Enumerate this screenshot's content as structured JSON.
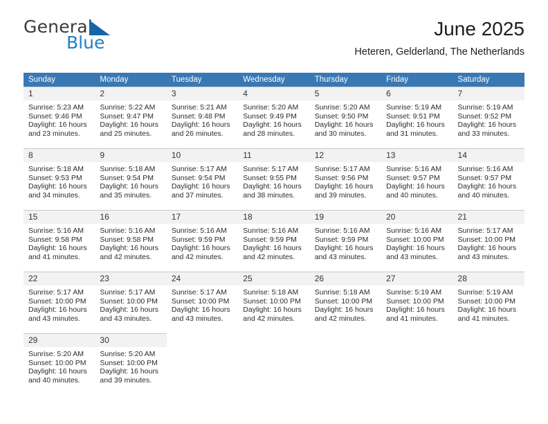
{
  "brand": {
    "name_top": "General",
    "name_bottom": "Blue",
    "triangle_color": "#1565a8",
    "blue_color": "#1f7fc4"
  },
  "header": {
    "title": "June 2025",
    "subtitle": "Heteren, Gelderland, The Netherlands"
  },
  "calendar": {
    "header_bg": "#3878b4",
    "daynum_bg": "#f2f2f2",
    "weekdays": [
      "Sunday",
      "Monday",
      "Tuesday",
      "Wednesday",
      "Thursday",
      "Friday",
      "Saturday"
    ],
    "weeks": [
      [
        {
          "day": "1",
          "sunrise": "Sunrise: 5:23 AM",
          "sunset": "Sunset: 9:46 PM",
          "daylight_1": "Daylight: 16 hours",
          "daylight_2": "and 23 minutes."
        },
        {
          "day": "2",
          "sunrise": "Sunrise: 5:22 AM",
          "sunset": "Sunset: 9:47 PM",
          "daylight_1": "Daylight: 16 hours",
          "daylight_2": "and 25 minutes."
        },
        {
          "day": "3",
          "sunrise": "Sunrise: 5:21 AM",
          "sunset": "Sunset: 9:48 PM",
          "daylight_1": "Daylight: 16 hours",
          "daylight_2": "and 26 minutes."
        },
        {
          "day": "4",
          "sunrise": "Sunrise: 5:20 AM",
          "sunset": "Sunset: 9:49 PM",
          "daylight_1": "Daylight: 16 hours",
          "daylight_2": "and 28 minutes."
        },
        {
          "day": "5",
          "sunrise": "Sunrise: 5:20 AM",
          "sunset": "Sunset: 9:50 PM",
          "daylight_1": "Daylight: 16 hours",
          "daylight_2": "and 30 minutes."
        },
        {
          "day": "6",
          "sunrise": "Sunrise: 5:19 AM",
          "sunset": "Sunset: 9:51 PM",
          "daylight_1": "Daylight: 16 hours",
          "daylight_2": "and 31 minutes."
        },
        {
          "day": "7",
          "sunrise": "Sunrise: 5:19 AM",
          "sunset": "Sunset: 9:52 PM",
          "daylight_1": "Daylight: 16 hours",
          "daylight_2": "and 33 minutes."
        }
      ],
      [
        {
          "day": "8",
          "sunrise": "Sunrise: 5:18 AM",
          "sunset": "Sunset: 9:53 PM",
          "daylight_1": "Daylight: 16 hours",
          "daylight_2": "and 34 minutes."
        },
        {
          "day": "9",
          "sunrise": "Sunrise: 5:18 AM",
          "sunset": "Sunset: 9:54 PM",
          "daylight_1": "Daylight: 16 hours",
          "daylight_2": "and 35 minutes."
        },
        {
          "day": "10",
          "sunrise": "Sunrise: 5:17 AM",
          "sunset": "Sunset: 9:54 PM",
          "daylight_1": "Daylight: 16 hours",
          "daylight_2": "and 37 minutes."
        },
        {
          "day": "11",
          "sunrise": "Sunrise: 5:17 AM",
          "sunset": "Sunset: 9:55 PM",
          "daylight_1": "Daylight: 16 hours",
          "daylight_2": "and 38 minutes."
        },
        {
          "day": "12",
          "sunrise": "Sunrise: 5:17 AM",
          "sunset": "Sunset: 9:56 PM",
          "daylight_1": "Daylight: 16 hours",
          "daylight_2": "and 39 minutes."
        },
        {
          "day": "13",
          "sunrise": "Sunrise: 5:16 AM",
          "sunset": "Sunset: 9:57 PM",
          "daylight_1": "Daylight: 16 hours",
          "daylight_2": "and 40 minutes."
        },
        {
          "day": "14",
          "sunrise": "Sunrise: 5:16 AM",
          "sunset": "Sunset: 9:57 PM",
          "daylight_1": "Daylight: 16 hours",
          "daylight_2": "and 40 minutes."
        }
      ],
      [
        {
          "day": "15",
          "sunrise": "Sunrise: 5:16 AM",
          "sunset": "Sunset: 9:58 PM",
          "daylight_1": "Daylight: 16 hours",
          "daylight_2": "and 41 minutes."
        },
        {
          "day": "16",
          "sunrise": "Sunrise: 5:16 AM",
          "sunset": "Sunset: 9:58 PM",
          "daylight_1": "Daylight: 16 hours",
          "daylight_2": "and 42 minutes."
        },
        {
          "day": "17",
          "sunrise": "Sunrise: 5:16 AM",
          "sunset": "Sunset: 9:59 PM",
          "daylight_1": "Daylight: 16 hours",
          "daylight_2": "and 42 minutes."
        },
        {
          "day": "18",
          "sunrise": "Sunrise: 5:16 AM",
          "sunset": "Sunset: 9:59 PM",
          "daylight_1": "Daylight: 16 hours",
          "daylight_2": "and 42 minutes."
        },
        {
          "day": "19",
          "sunrise": "Sunrise: 5:16 AM",
          "sunset": "Sunset: 9:59 PM",
          "daylight_1": "Daylight: 16 hours",
          "daylight_2": "and 43 minutes."
        },
        {
          "day": "20",
          "sunrise": "Sunrise: 5:16 AM",
          "sunset": "Sunset: 10:00 PM",
          "daylight_1": "Daylight: 16 hours",
          "daylight_2": "and 43 minutes."
        },
        {
          "day": "21",
          "sunrise": "Sunrise: 5:17 AM",
          "sunset": "Sunset: 10:00 PM",
          "daylight_1": "Daylight: 16 hours",
          "daylight_2": "and 43 minutes."
        }
      ],
      [
        {
          "day": "22",
          "sunrise": "Sunrise: 5:17 AM",
          "sunset": "Sunset: 10:00 PM",
          "daylight_1": "Daylight: 16 hours",
          "daylight_2": "and 43 minutes."
        },
        {
          "day": "23",
          "sunrise": "Sunrise: 5:17 AM",
          "sunset": "Sunset: 10:00 PM",
          "daylight_1": "Daylight: 16 hours",
          "daylight_2": "and 43 minutes."
        },
        {
          "day": "24",
          "sunrise": "Sunrise: 5:17 AM",
          "sunset": "Sunset: 10:00 PM",
          "daylight_1": "Daylight: 16 hours",
          "daylight_2": "and 43 minutes."
        },
        {
          "day": "25",
          "sunrise": "Sunrise: 5:18 AM",
          "sunset": "Sunset: 10:00 PM",
          "daylight_1": "Daylight: 16 hours",
          "daylight_2": "and 42 minutes."
        },
        {
          "day": "26",
          "sunrise": "Sunrise: 5:18 AM",
          "sunset": "Sunset: 10:00 PM",
          "daylight_1": "Daylight: 16 hours",
          "daylight_2": "and 42 minutes."
        },
        {
          "day": "27",
          "sunrise": "Sunrise: 5:19 AM",
          "sunset": "Sunset: 10:00 PM",
          "daylight_1": "Daylight: 16 hours",
          "daylight_2": "and 41 minutes."
        },
        {
          "day": "28",
          "sunrise": "Sunrise: 5:19 AM",
          "sunset": "Sunset: 10:00 PM",
          "daylight_1": "Daylight: 16 hours",
          "daylight_2": "and 41 minutes."
        }
      ],
      [
        {
          "day": "29",
          "sunrise": "Sunrise: 5:20 AM",
          "sunset": "Sunset: 10:00 PM",
          "daylight_1": "Daylight: 16 hours",
          "daylight_2": "and 40 minutes."
        },
        {
          "day": "30",
          "sunrise": "Sunrise: 5:20 AM",
          "sunset": "Sunset: 10:00 PM",
          "daylight_1": "Daylight: 16 hours",
          "daylight_2": "and 39 minutes."
        },
        {
          "day": "",
          "sunrise": "",
          "sunset": "",
          "daylight_1": "",
          "daylight_2": ""
        },
        {
          "day": "",
          "sunrise": "",
          "sunset": "",
          "daylight_1": "",
          "daylight_2": ""
        },
        {
          "day": "",
          "sunrise": "",
          "sunset": "",
          "daylight_1": "",
          "daylight_2": ""
        },
        {
          "day": "",
          "sunrise": "",
          "sunset": "",
          "daylight_1": "",
          "daylight_2": ""
        },
        {
          "day": "",
          "sunrise": "",
          "sunset": "",
          "daylight_1": "",
          "daylight_2": ""
        }
      ]
    ]
  }
}
